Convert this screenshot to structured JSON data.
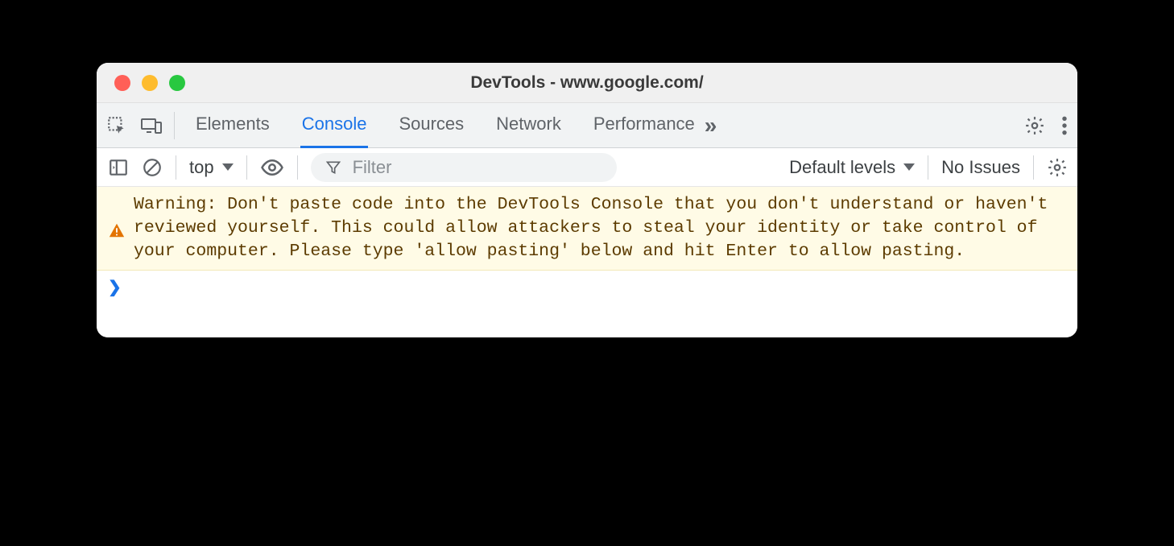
{
  "window": {
    "title": "DevTools - www.google.com/"
  },
  "tabs": {
    "items": [
      {
        "label": "Elements",
        "active": false
      },
      {
        "label": "Console",
        "active": true
      },
      {
        "label": "Sources",
        "active": false
      },
      {
        "label": "Network",
        "active": false
      },
      {
        "label": "Performance",
        "active": false
      }
    ],
    "overflow": "»"
  },
  "toolbar": {
    "context": "top",
    "filter_placeholder": "Filter",
    "levels_label": "Default levels",
    "issues_label": "No Issues"
  },
  "console": {
    "warning": "Warning: Don't paste code into the DevTools Console that you don't understand or haven't reviewed yourself. This could allow attackers to steal your identity or take control of your computer. Please type 'allow pasting' below and hit Enter to allow pasting.",
    "prompt": ""
  },
  "colors": {
    "accent": "#1a73e8",
    "warning_bg": "#fffbe6",
    "warning_fg": "#5c3b00"
  }
}
